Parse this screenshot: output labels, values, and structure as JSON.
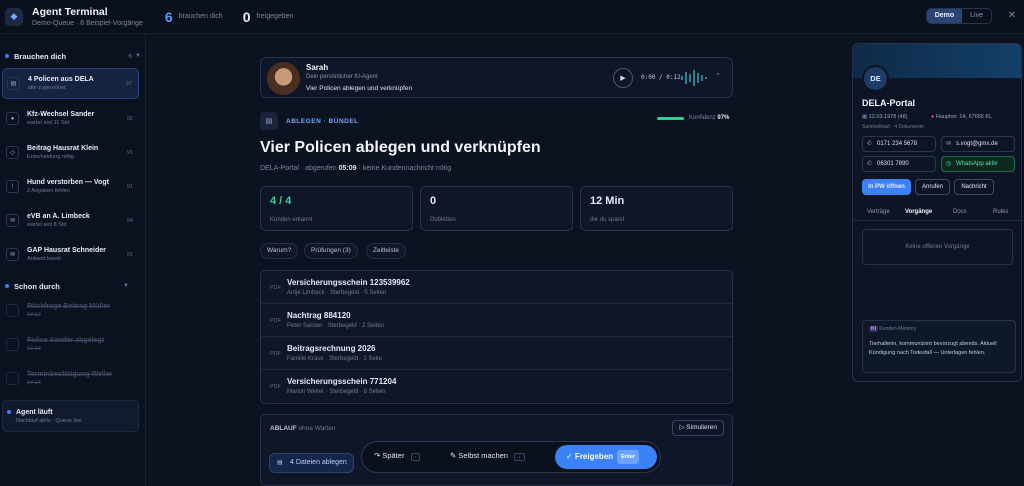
{
  "header": {
    "title": "Agent Terminal",
    "subtitle": "Demo-Queue · 6 Beispiel-Vorgänge",
    "stats": [
      {
        "value": "6",
        "label": "brauchen dich",
        "color": "#5b9bff"
      },
      {
        "value": "0",
        "label": "freigegeben",
        "color": "#ffffff"
      }
    ],
    "mode_demo": "Demo",
    "mode_live": "Live",
    "close": "✕"
  },
  "sidebar": {
    "section1": {
      "title": "Brauchen dich",
      "count": "6"
    },
    "items": [
      {
        "title": "4 Policen aus DELA",
        "sub": "alle zugeordnet",
        "num": "97"
      },
      {
        "title": "Kfz-Wechsel Sander",
        "sub": "wartet seit 11 Std",
        "num": "92"
      },
      {
        "title": "Beitrag Hausrat Klein",
        "sub": "Entscheidung nötig",
        "num": "91"
      },
      {
        "title": "Hund verstorben — Vogt",
        "sub": "2 Angaben fehlen",
        "num": "91"
      },
      {
        "title": "eVB an A. Limbeck",
        "sub": "wartet seit 8 Std",
        "num": "94"
      },
      {
        "title": "GAP Hausrat Schneider",
        "sub": "Antwort bereit",
        "num": "91"
      }
    ],
    "section2": {
      "title": "Schon durch"
    },
    "done": [
      {
        "title": "Rückfrage Beitrag Müller",
        "sub": "07:12"
      },
      {
        "title": "Police Sander abgelegt",
        "sub": "07:13"
      },
      {
        "title": "Terminbestätigung Weller",
        "sub": "07:14"
      }
    ],
    "agent": {
      "title": "Agent läuft",
      "sub": "Nachlauf aktiv · Queue live"
    }
  },
  "voice": {
    "name": "Sarah",
    "role": "Dein persönlicher KI-Agent",
    "line": "Vier Policen ablegen und verknüpfen",
    "time": "0:00 / 0:12"
  },
  "task": {
    "tag": "ABLEGEN · BÜNDEL",
    "confidence_label": "Konfidenz",
    "confidence": "97%",
    "confidence_value": 0.97,
    "title": "Vier Policen ablegen und verknüpfen",
    "meta_source": "DELA-Portal",
    "meta_called": "abgerufen",
    "meta_time": "05:09",
    "meta_rest": "keine Kundennachricht nötig"
  },
  "kpis": [
    {
      "value": "4 / 4",
      "label": "Kunden erkannt",
      "color": "#3ccf91"
    },
    {
      "value": "0",
      "label": "Dubletten",
      "color": "#eef2f8"
    },
    {
      "value": "12 Min",
      "label": "die du sparst",
      "color": "#eef2f8"
    }
  ],
  "chips": [
    "Warum?",
    "Prüfungen (3)",
    "Zeitleiste"
  ],
  "docs": [
    {
      "type": "PDF",
      "title": "Versicherungsschein 123539962",
      "sub": "Antje Limbeck · Sterbegeld · 5 Seiten"
    },
    {
      "type": "PDF",
      "title": "Nachtrag 884120",
      "sub": "Peter Sander · Sterbegeld · 2 Seiten"
    },
    {
      "type": "PDF",
      "title": "Beitragsrechnung 2026",
      "sub": "Familie Kraus · Sterbegeld · 1 Seite"
    },
    {
      "type": "PDF",
      "title": "Versicherungsschein 771204",
      "sub": "Marion Weller · Sterbegeld · 6 Seiten"
    }
  ],
  "flow": {
    "label": "ABLAUF",
    "sub": "ohne Warten",
    "simulate": "▷ Simulieren",
    "files_btn": "4 Dateien ablegen",
    "later": "↷ Später",
    "later_key": "·",
    "self": "✎ Selbst machen",
    "self_key": "↓",
    "approve": "✓ Freigeben",
    "approve_key": "Enter"
  },
  "customer": {
    "initials": "DE",
    "name": "DELA-Portal",
    "birth": "12.03.1978 (48)",
    "address": "Hauptstr. 14, 67655 KL",
    "meta": "Sammelkauf · 4 Dokumente",
    "phone1": "0171 234 5678",
    "email": "s.vogt@gmx.de",
    "phone2": "06301 7890",
    "whatsapp": "WhatsApp aktiv",
    "btn_open": "In PW öffnen",
    "btn_call": "Anrufen",
    "btn_msg": "Nachricht",
    "tabs": [
      "Verträge",
      "Vorgänge",
      "Docs",
      "Rules"
    ],
    "empty": "Keine offenen Vorgänge",
    "memory_tag": "KI",
    "memory_label": "Kunden-Memory",
    "memory_text": "Tierhalterin, kommuniziert bevorzugt abends. Aktuell Kündigung nach Todesfall — Unterlagen fehlen."
  }
}
